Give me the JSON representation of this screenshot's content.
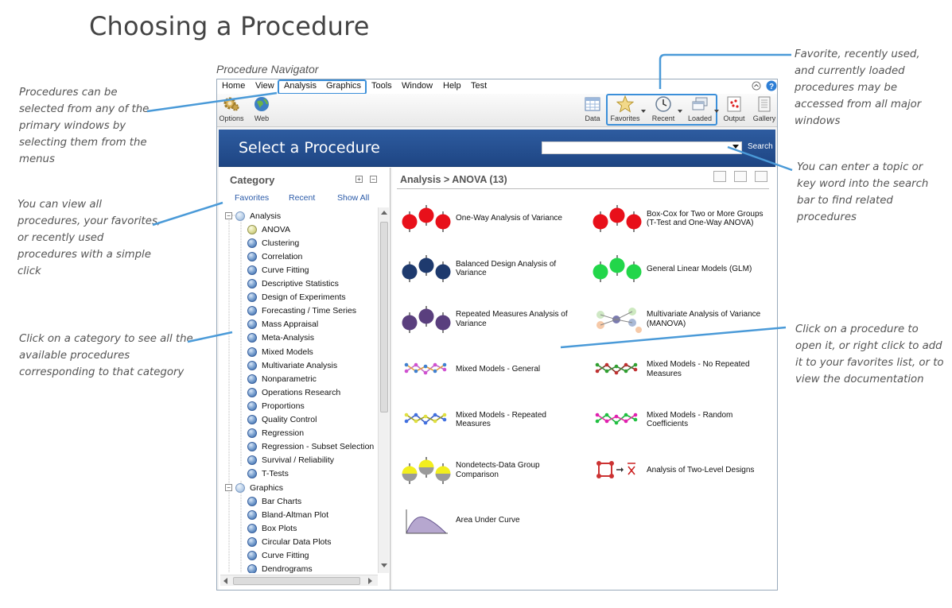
{
  "page_title": "Choosing a Procedure",
  "navigator_caption": "Procedure Navigator",
  "annotations": [
    "Procedures can be selected from any of the primary windows by selecting them from the menus",
    "You can view all procedures, your favorites, or recently used procedures with a simple click",
    "Click on a category to see all the available procedures corresponding to that category",
    "Favorite, recently used, and currently loaded procedures may be accessed from all major windows",
    "You can enter a topic or key word into the search bar to find related procedures",
    "Click on a procedure to open it, or right click to add it to your favorites list, or to view the documentation"
  ],
  "menu": [
    "Home",
    "View",
    "Analysis",
    "Graphics",
    "Tools",
    "Window",
    "Help",
    "Test"
  ],
  "toolbar": {
    "options": "Options",
    "web": "Web",
    "data": "Data",
    "favorites": "Favorites",
    "recent": "Recent",
    "loaded": "Loaded",
    "output": "Output",
    "gallery": "Gallery"
  },
  "header": {
    "title": "Select a Procedure",
    "search_value": "",
    "search_button": "Search"
  },
  "category": {
    "title": "Category",
    "tabs": [
      "Favorites",
      "Recent",
      "Show All"
    ],
    "groups": [
      {
        "label": "Analysis",
        "items": [
          "ANOVA",
          "Clustering",
          "Correlation",
          "Curve Fitting",
          "Descriptive Statistics",
          "Design of Experiments",
          "Forecasting / Time Series",
          "Mass Appraisal",
          "Meta-Analysis",
          "Mixed Models",
          "Multivariate Analysis",
          "Nonparametric",
          "Operations Research",
          "Proportions",
          "Quality Control",
          "Regression",
          "Regression - Subset Selection",
          "Survival / Reliability",
          "T-Tests"
        ]
      },
      {
        "label": "Graphics",
        "items": [
          "Bar Charts",
          "Bland-Altman Plot",
          "Box Plots",
          "Circular Data Plots",
          "Curve Fitting",
          "Dendrograms"
        ]
      }
    ],
    "selected": "ANOVA"
  },
  "breadcrumb": "Analysis > ANOVA (13)",
  "procedures": [
    "One-Way Analysis of Variance",
    "Box-Cox for Two or More Groups (T-Test and One-Way ANOVA)",
    "Balanced Design Analysis of Variance",
    "General Linear Models (GLM)",
    "Repeated Measures Analysis of Variance",
    "Multivariate Analysis of Variance (MANOVA)",
    "Mixed Models - General",
    "Mixed Models - No Repeated Measures",
    "Mixed Models - Repeated Measures",
    "Mixed Models - Random Coefficients",
    "Nondetects-Data Group Comparison",
    "Analysis of Two-Level Designs",
    "Area Under Curve"
  ],
  "colors": {
    "accent": "#3b8fd9",
    "header": "#2a5599",
    "red": "#e8101a",
    "navy": "#1e3a6e",
    "green": "#22d64a",
    "purple": "#5a3f7e",
    "yellow": "#f2ee1e"
  },
  "icons": [
    "gear-icon",
    "globe-icon",
    "data-icon",
    "star-icon",
    "clock-icon",
    "loaded-icon",
    "output-icon",
    "gallery-icon",
    "help-icon"
  ]
}
